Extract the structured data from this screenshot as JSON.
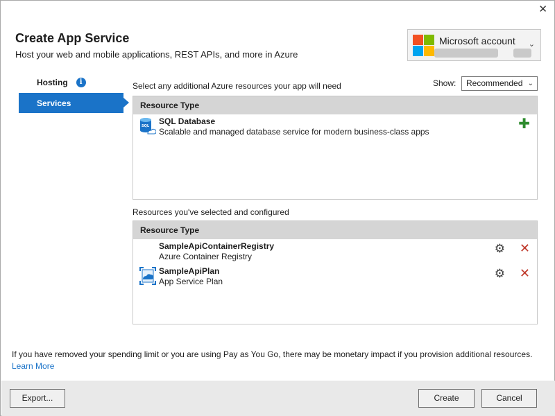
{
  "header": {
    "title": "Create App Service",
    "subtitle": "Host your web and mobile applications, REST APIs, and more in Azure"
  },
  "account": {
    "name": "Microsoft account"
  },
  "nav": {
    "items": [
      {
        "label": "Hosting",
        "active": false
      },
      {
        "label": "Services",
        "active": true
      }
    ]
  },
  "services": {
    "prompt": "Select any additional Azure resources your app will need",
    "show_label": "Show:",
    "show_value": "Recommended",
    "available": {
      "header": "Resource Type",
      "rows": [
        {
          "title": "SQL Database",
          "description": "Scalable and managed database service for modern business-class apps"
        }
      ]
    },
    "selected_label": "Resources you've selected and configured",
    "selected": {
      "header": "Resource Type",
      "rows": [
        {
          "title": "SampleApiContainerRegistry",
          "description": "Azure Container Registry"
        },
        {
          "title": "SampleApiPlan",
          "description": "App Service Plan"
        }
      ]
    }
  },
  "notice": {
    "text": "If you have removed your spending limit or you are using Pay as You Go, there may be monetary impact if you provision additional resources.",
    "link": "Learn More"
  },
  "buttons": {
    "export": "Export...",
    "create": "Create",
    "cancel": "Cancel"
  },
  "colors": {
    "accent": "#1a73c8",
    "add": "#2e8b2e",
    "delete": "#c0392b"
  }
}
